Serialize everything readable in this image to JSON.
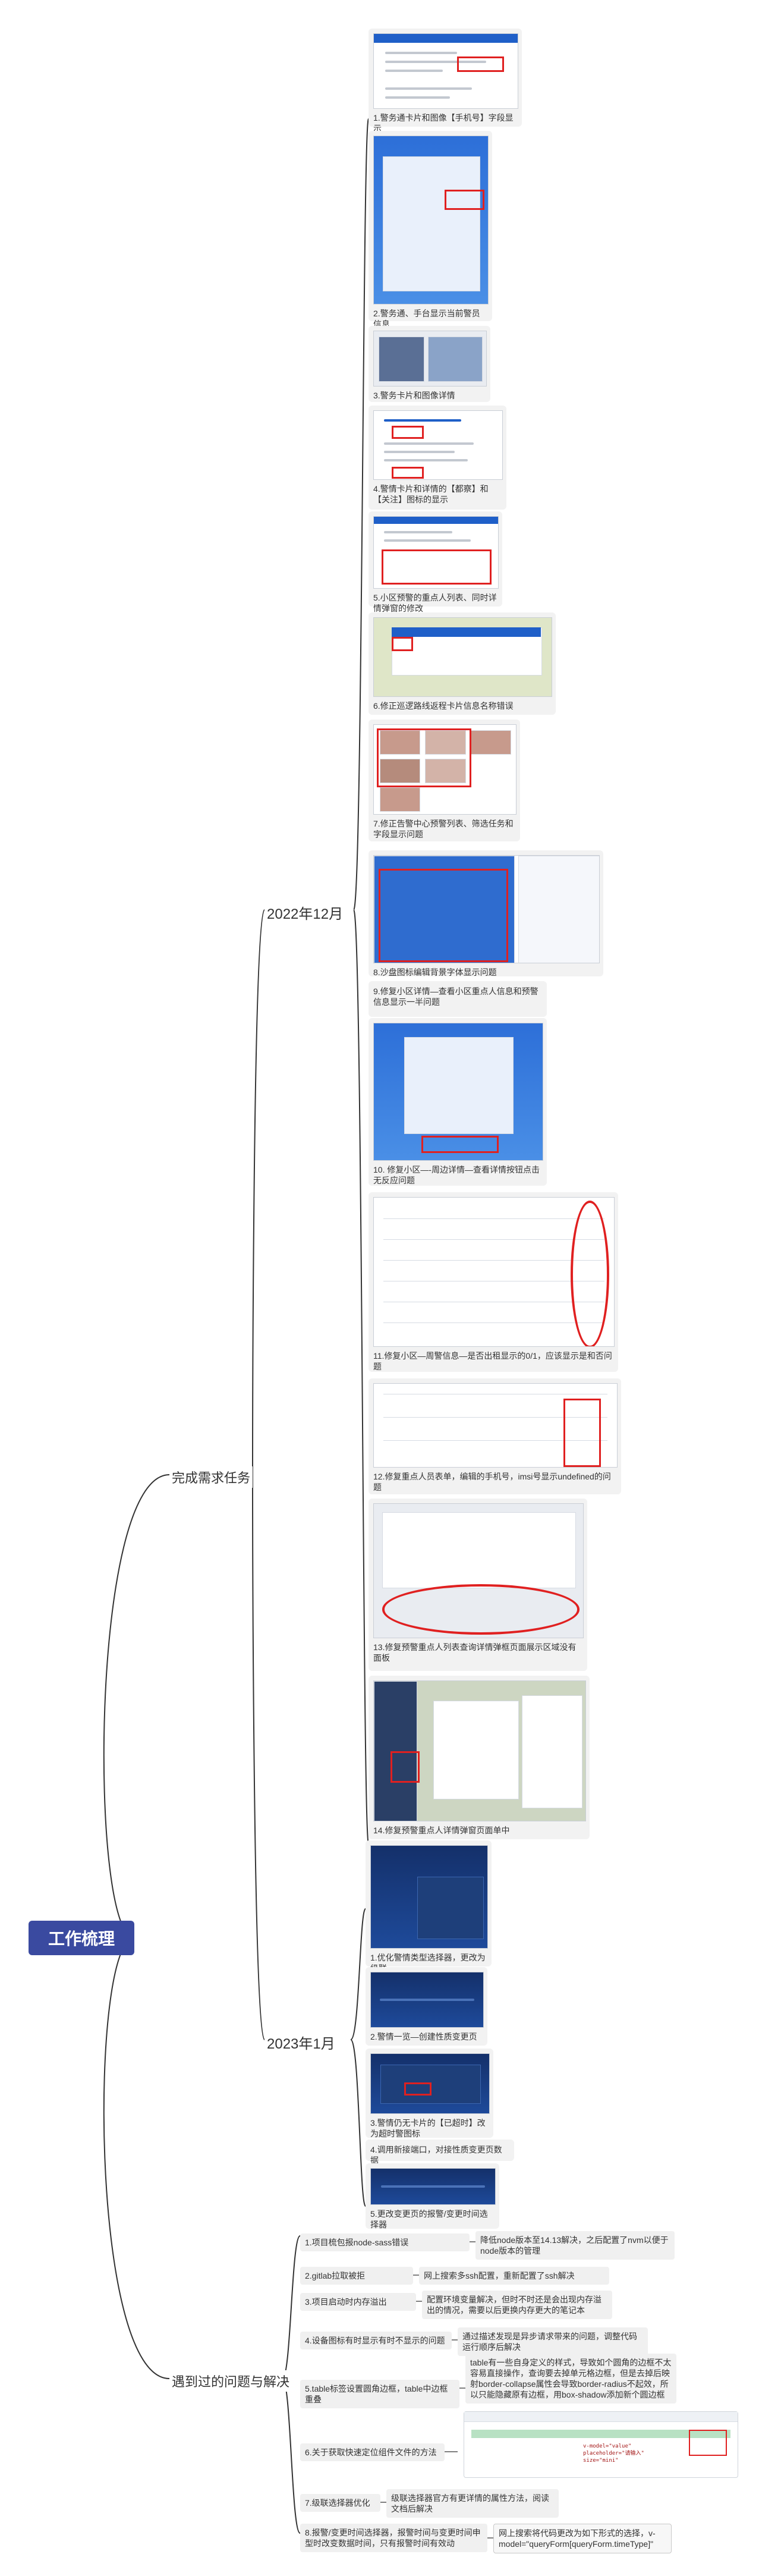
{
  "root": "工作梳理",
  "branches": {
    "tasks": "完成需求任务",
    "issues": "遇到过的问题与解决"
  },
  "months": {
    "dec": "2022年12月",
    "jan": "2023年1月"
  },
  "dec_items": [
    "1.警务通卡片和图像【手机号】字段显示",
    "2.警务通、手台显示当前警员信息",
    "3.警务卡片和图像详情",
    "4.警情卡片和详情的【都察】和【关注】图标的显示",
    "5.小区预警的重点人列表、同时详情弹窗的修改",
    "6.修正巡逻路线返程卡片信息名称错误",
    "7.修正告警中心预警列表、筛选任务和字段显示问题",
    "8.沙盘图标编辑背景字体显示问题",
    "9.修复小区详情—查看小区重点人信息和预警信息显示一半问题",
    "10. 修复小区—-周边详情—查看详情按钮点击无反应问题",
    "11.修复小区—周警信息—是否出租显示的0/1，应该显示是和否问题",
    "12.修复重点人员表单，编辑的手机号，imsi号显示undefined的问题",
    "13.修复预警重点人列表查询详情弹框页面展示区域没有面板",
    "14.修复预警重点人详情弹窗页面单中"
  ],
  "jan_items": [
    "1.优化警情类型选择器，更改为级联",
    "2.警情一览—创建性质变更页",
    "3.警情仍无卡片的【已超时】改为超时警图标",
    "4.调用新接端口，对接性质变更页数据",
    "5.更改变更页的报警/变更时间选择器"
  ],
  "issues": [
    {
      "q": "1.项目梳包报node-sass错误",
      "a": "降低node版本至14.13解决，之后配置了nvm以便于node版本的管理"
    },
    {
      "q": "2.gitlab拉取被拒",
      "a": "网上搜索多ssh配置，重新配置了ssh解决"
    },
    {
      "q": "3.项目启动时内存溢出",
      "a": "配置环境变量解决，但时不时还是会出现内存溢出的情况，需要以后更换内存更大的笔记本"
    },
    {
      "q": "4.设备图标有时显示有时不显示的问题",
      "a": "通过描述发现是异步请求带来的问题，调整代码运行顺序后解决"
    },
    {
      "q": "5.table标签设置圆角边框，table中边框重叠",
      "a": "table有一些自身定义的样式，导致如个圆角的边框不太容易直接操作，查询要去掉单元格边框，但是去掉后映射border-collapse属性会导致border-radius不起效，所以只能隐藏原有边框，用box-shadow添加新个圆边框"
    },
    {
      "q": "6.关于获取快速定位组件文件的方法",
      "a": ""
    },
    {
      "q": "7.级联选择器优化",
      "a": "级联选择器官方有更详情的属性方法，阅读文档后解决"
    },
    {
      "q": "8.报警/变更时间选择器，报警时间与变更时间申型时改变数据时间，只有报警时间有效动",
      "a": "网上搜索将代码更改为如下形式的选择，v-model=\"queryForm[queryForm.timeType]\""
    }
  ],
  "code_shot": {
    "line1": "v-model=\"value\"",
    "line2": "placeholder=\"请输入\"",
    "line3": "size=\"mini\""
  }
}
